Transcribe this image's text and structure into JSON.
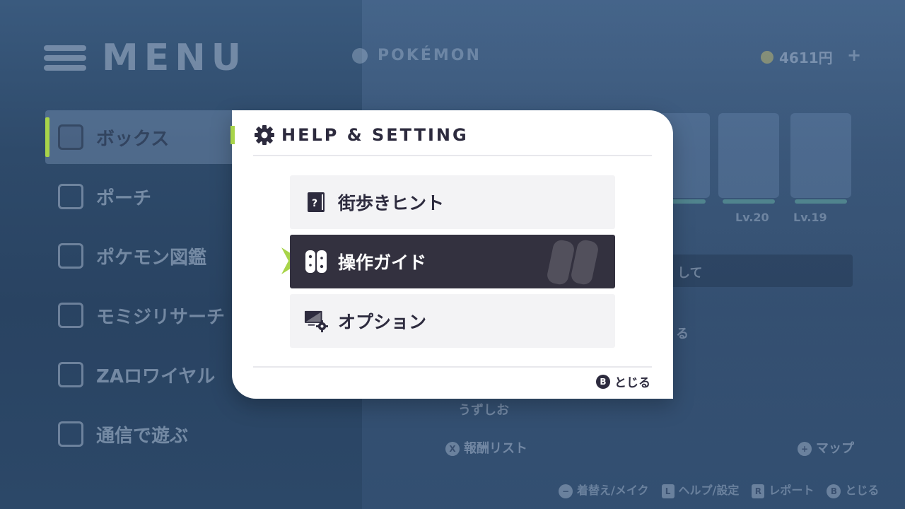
{
  "background": {
    "menu_title": "MENU",
    "pokemon_tag": "POKÉMON",
    "money": "4611円",
    "money_plus": "+",
    "sidebar": [
      {
        "label": "ボックス",
        "active": true
      },
      {
        "label": "ポーチ",
        "active": false
      },
      {
        "label": "ポケモン図鑑",
        "active": false
      },
      {
        "label": "モミジリサーチ",
        "active": false
      },
      {
        "label": "ZAロワイヤル",
        "active": false
      },
      {
        "label": "通信で遊ぶ",
        "active": false
      }
    ],
    "levels": [
      "Lv.20",
      "Lv.19"
    ],
    "partial_texts": {
      "shite": "して",
      "ru": "る",
      "name": "うずしお",
      "reward_list": "報酬リスト",
      "map": "マップ"
    },
    "button_glyphs": {
      "x": "X",
      "plus": "+",
      "minus": "−",
      "l": "L",
      "r": "R",
      "b": "B"
    },
    "footer": {
      "dress": "着替え/メイク",
      "help": "ヘルプ/設定",
      "report": "レポート",
      "close": "とじる"
    }
  },
  "dialog": {
    "title": "HELP & SETTING",
    "options": [
      {
        "label": "街歩きヒント",
        "icon": "hint-book-icon",
        "selected": false
      },
      {
        "label": "操作ガイド",
        "icon": "joycon-icon",
        "selected": true
      },
      {
        "label": "オプション",
        "icon": "options-monitor-gear-icon",
        "selected": false
      }
    ],
    "close_button": "B",
    "close_label": "とじる"
  },
  "colors": {
    "accent": "#a8d44a",
    "dark": "#2d2b3e",
    "selected_bg": "#33313f",
    "option_bg": "#f3f3f5"
  }
}
